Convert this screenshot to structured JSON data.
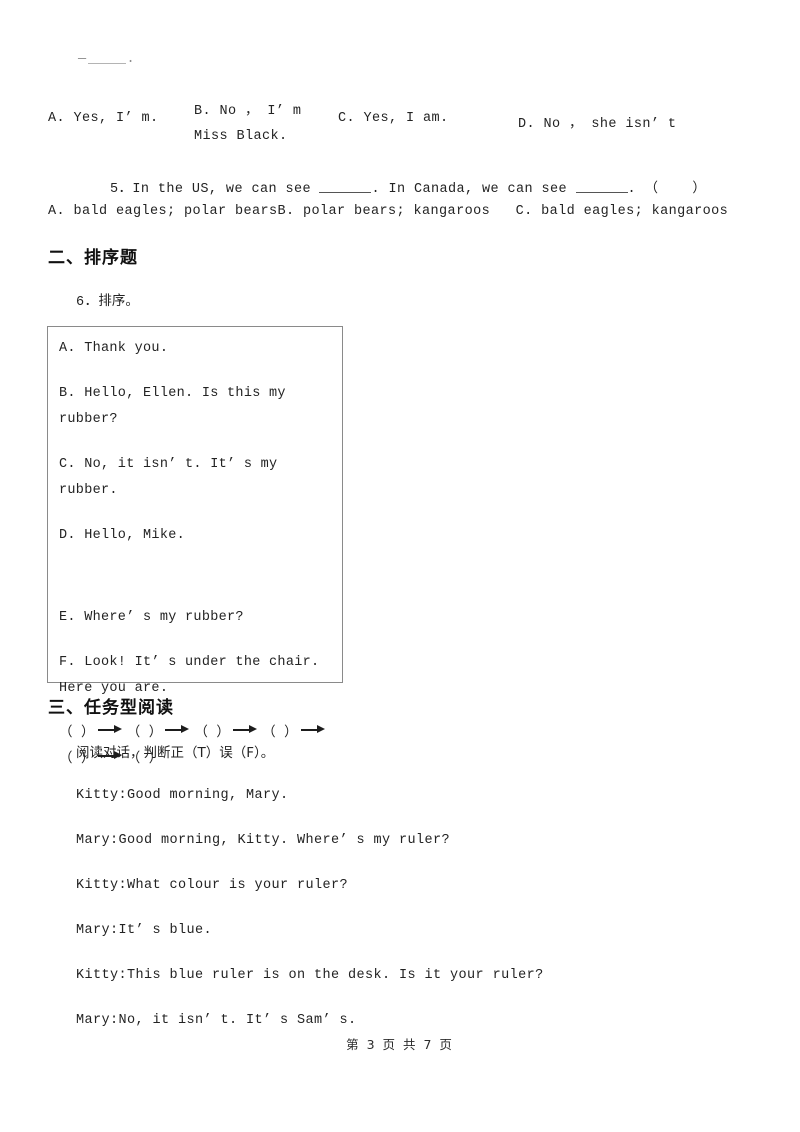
{
  "document": {
    "page_label": "第 3 页 共 7 页"
  },
  "top_fragment": {
    "prefix": "—",
    "suffix": "."
  },
  "question4": {
    "options": [
      "A. Yes, I’ m.",
      "B. No ， I’ m Miss Black.",
      "C. Yes, I am.",
      "D. No ， she isn’ t"
    ]
  },
  "question5": {
    "number": "5．",
    "text_part1": "In the US, we can see ",
    "text_part2": ". In Canada, we can see ",
    "text_part3": ". （    ）",
    "options_line": "A. bald eagles; polar bearsB. polar bears; kangaroos   C. bald eagles; kangaroos"
  },
  "section2": {
    "heading": "二、排序题",
    "question_number": "6．",
    "prompt": "排序。",
    "items": [
      "A. Thank you.",
      "B. Hello, Ellen. Is this my rubber?",
      "C. No, it isn’ t. It’ s my rubber.",
      "D. Hello, Mike.",
      "E. Where’ s my rubber?",
      "F. Look! It’ s under the chair. Here you are."
    ],
    "sequence": {
      "slots": 6,
      "slot_text": "（        ）",
      "arrow_icon": "right-arrow-icon"
    }
  },
  "section3": {
    "heading": "三、任务型阅读",
    "instruction": "阅读对话，判断正（T）误（F）。",
    "dialogue": [
      "Kitty:Good morning, Mary.",
      "Mary:Good morning, Kitty. Where’ s my ruler?",
      "Kitty:What colour is your ruler?",
      "Mary:It’ s blue.",
      "Kitty:This blue ruler is on the desk. Is it your ruler?",
      "Mary:No, it isn’ t. It’ s Sam’ s."
    ]
  }
}
